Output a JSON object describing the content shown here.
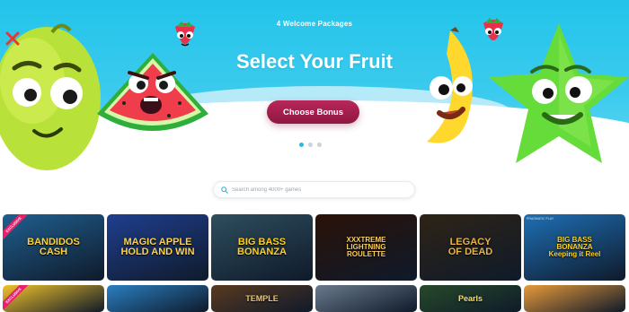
{
  "hero": {
    "eyebrow": "4 Welcome Packages",
    "title": "Select Your Fruit",
    "cta_label": "Choose Bonus",
    "slides": 3,
    "active_slide": 1
  },
  "search": {
    "placeholder": "Search among 4000+ games"
  },
  "games_row1": [
    {
      "title": "BANDIDOS\nCASH",
      "badge": "EXCLUSIVE",
      "bg": "#1f5f8f",
      "fg": "#ffd23a"
    },
    {
      "title": "MAGIC APPLE\nHOLD AND WIN",
      "bg": "#1f3f8f",
      "fg": "#ffd34a"
    },
    {
      "title": "BIG BASS\nBONANZA",
      "bg": "#2e4e5e",
      "fg": "#ffd21f"
    },
    {
      "title": "XXXTREME\nLIGHTNING\nROULETTE",
      "bg": "#2a1208",
      "fg": "#ffcf5a"
    },
    {
      "title": "LEGACY\nOF DEAD",
      "bg": "#2e2416",
      "fg": "#e8b44a"
    },
    {
      "title": "BIG BASS\nBONANZA\nKeeping it Reel",
      "provider": "PRAGMATIC PLAY",
      "bg": "#1e6fb5",
      "fg": "#ffd21f"
    }
  ],
  "games_row2": [
    {
      "title": "",
      "badge": "EXCLUSIVE",
      "bg": "#f2c22a"
    },
    {
      "title": "",
      "bg": "#2a7fc2"
    },
    {
      "title": "TEMPLE",
      "bg": "#5a3a20",
      "fg": "#f0c870"
    },
    {
      "title": "",
      "bg": "#6a7b8d"
    },
    {
      "title": "Pearls",
      "bg": "#264a2a",
      "fg": "#ffe36a"
    },
    {
      "title": "",
      "bg": "#e79a3a"
    }
  ]
}
